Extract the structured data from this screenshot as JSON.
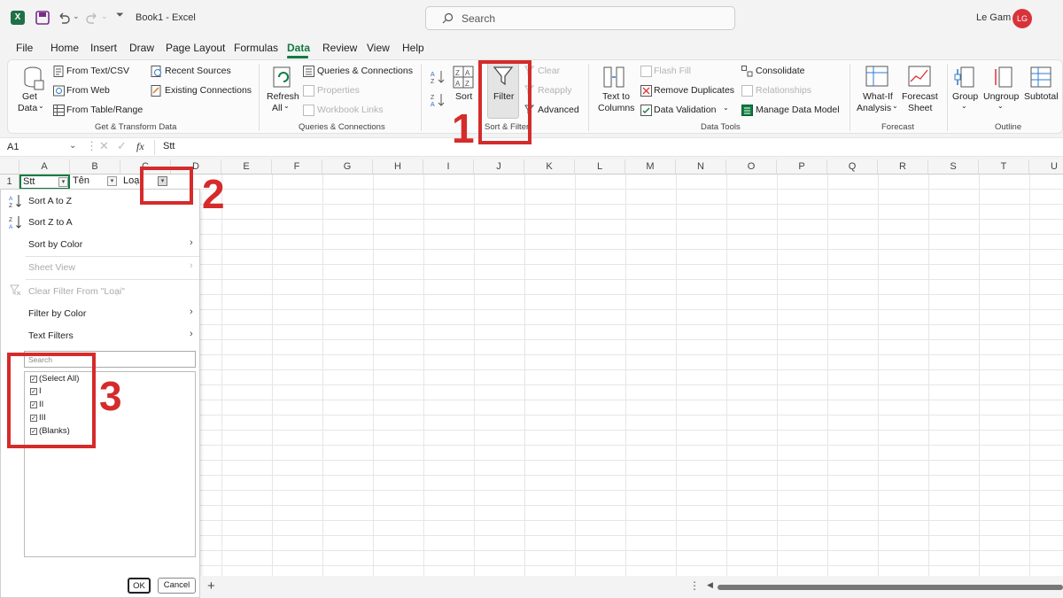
{
  "titlebar": {
    "title": "Book1  -  Excel",
    "search_placeholder": "Search",
    "user_name": "Le Gam",
    "avatar_initials": "LG"
  },
  "menu": [
    "File",
    "Home",
    "Insert",
    "Draw",
    "Page Layout",
    "Formulas",
    "Data",
    "Review",
    "View",
    "Help"
  ],
  "ribbon": {
    "get_transform": {
      "get_data": "Get",
      "get_data2": "Data",
      "from_text_csv": "From Text/CSV",
      "from_web": "From Web",
      "from_table_range": "From Table/Range",
      "recent_sources": "Recent Sources",
      "existing_connections": "Existing Connections",
      "label": "Get & Transform Data"
    },
    "queries": {
      "refresh": "Refresh",
      "refresh_all": "All",
      "queries_connections": "Queries & Connections",
      "properties": "Properties",
      "workbook_links": "Workbook Links",
      "label": "Queries & Connections"
    },
    "sort_filter": {
      "sort": "Sort",
      "filter": "Filter",
      "clear": "Clear",
      "reapply": "Reapply",
      "advanced": "Advanced",
      "label": "Sort & Filter"
    },
    "data_tools": {
      "text_to": "Text to",
      "columns": "Columns",
      "flash_fill": "Flash Fill",
      "remove_duplicates": "Remove Duplicates",
      "data_validation": "Data Validation",
      "consolidate": "Consolidate",
      "relationships": "Relationships",
      "manage_data_model": "Manage Data Model",
      "label": "Data Tools"
    },
    "forecast": {
      "what_if": "What-If",
      "analysis": "Analysis",
      "forecast": "Forecast",
      "sheet": "Sheet",
      "label": "Forecast"
    },
    "outline": {
      "group": "Group",
      "ungroup": "Ungroup",
      "subtotal": "Subtotal",
      "label": "Outline"
    }
  },
  "formula_bar": {
    "name_box": "A1",
    "fx": "fx",
    "value": "Stt"
  },
  "grid": {
    "columns": [
      "A",
      "B",
      "C",
      "D",
      "E",
      "F",
      "G",
      "H",
      "I",
      "J",
      "K",
      "L",
      "M",
      "N",
      "O",
      "P",
      "Q",
      "R",
      "S",
      "T",
      "U"
    ],
    "row1": [
      "Stt",
      "Tên",
      "Loại"
    ],
    "row_num": "1"
  },
  "filter_menu": {
    "sort_a_z": "Sort A to Z",
    "sort_z_a": "Sort Z to A",
    "sort_by_color": "Sort by Color",
    "sheet_view": "Sheet View",
    "clear_filter": "Clear Filter From \"Loại\"",
    "filter_by_color": "Filter by Color",
    "text_filters": "Text Filters",
    "search_placeholder": "Search",
    "items": [
      "(Select All)",
      "I",
      "II",
      "III",
      "(Blanks)"
    ],
    "ok": "OK",
    "cancel": "Cancel"
  },
  "annotations": [
    "1",
    "2",
    "3"
  ],
  "colors": {
    "accent": "#107c41",
    "annotation": "#d52b2b"
  }
}
